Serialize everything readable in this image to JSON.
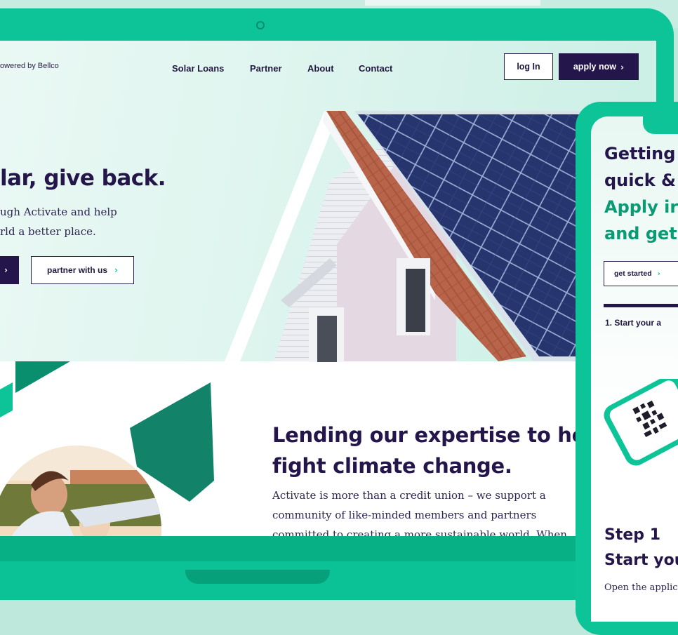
{
  "brand": {
    "text": "owered by Bellco"
  },
  "nav": {
    "links": [
      "Solar Loans",
      "Partner",
      "About",
      "Contact"
    ],
    "login_label": "log In",
    "apply_label": "apply now",
    "chevron": "›"
  },
  "hero": {
    "title": "lar, give back.",
    "subtitle_line1": "ugh Activate and help",
    "subtitle_line2": "rld a better place.",
    "cut_button_chevron": "›",
    "partner_label": "partner with us",
    "partner_chevron": "›"
  },
  "lending": {
    "title_line1": "Lending our expertise to hel",
    "title_line2": "fight climate change.",
    "body_line1": "Activate is more than a credit union – we support a",
    "body_line2": "community of like-minded members and partners",
    "body_line3": "committed to creating a more sustainable world. When"
  },
  "phone": {
    "title_line1": "Getting",
    "title_line2": "quick &",
    "title_line3": "Apply ir",
    "title_line4": "and get",
    "button_label": "get started",
    "button_chevron": "›",
    "step_line": "1. Start your a",
    "step_label": "Step 1",
    "step_title": "Start you",
    "open_text": "Open the applic"
  },
  "colors": {
    "brand_green": "#0cc497",
    "deep_purple": "#24164a",
    "accent_green_text": "#0a9a74"
  }
}
